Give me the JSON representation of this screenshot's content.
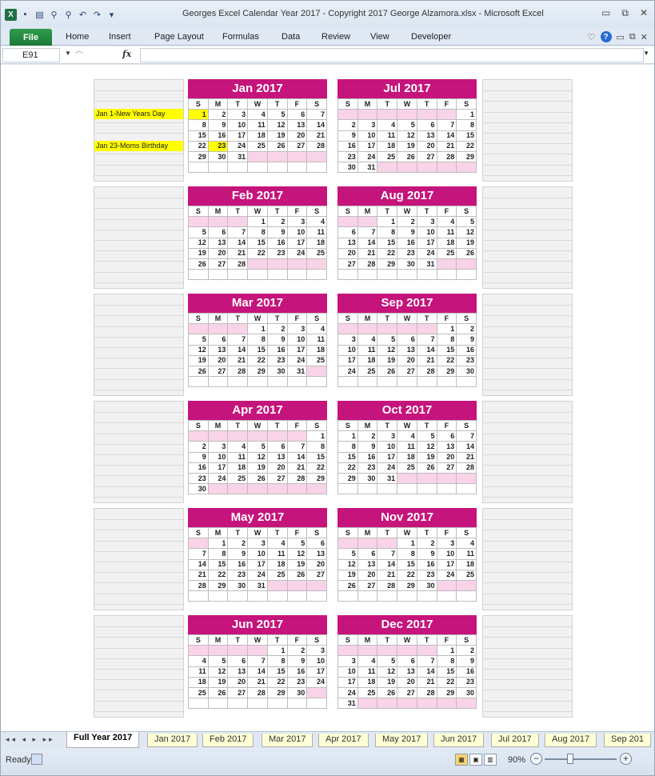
{
  "window": {
    "title": "Georges Excel Calendar Year 2017  -  Copyright 2017 George Alzamora.xlsx  -  Microsoft Excel",
    "minimize": "▭",
    "restore": "⧉",
    "close": "✕"
  },
  "ribbon": {
    "file": "File",
    "tabs": [
      "Home",
      "Insert",
      "Page Layout",
      "Formulas",
      "Data",
      "Review",
      "View",
      "Developer"
    ],
    "help": "?"
  },
  "formula_bar": {
    "name_box": "E91",
    "fx": "fx",
    "value": ""
  },
  "day_headers": [
    "S",
    "M",
    "T",
    "W",
    "T",
    "F",
    "S"
  ],
  "notes": {
    "jan1": "Jan 1-New Years Day",
    "jan23": "Jan 23-Moms Birthday"
  },
  "months": [
    {
      "name": "Jan 2017",
      "start": 0,
      "days": 31,
      "highlight": [
        1,
        23
      ]
    },
    {
      "name": "Feb 2017",
      "start": 3,
      "days": 28,
      "highlight": []
    },
    {
      "name": "Mar 2017",
      "start": 3,
      "days": 31,
      "highlight": []
    },
    {
      "name": "Apr 2017",
      "start": 6,
      "days": 30,
      "highlight": []
    },
    {
      "name": "May 2017",
      "start": 1,
      "days": 31,
      "highlight": []
    },
    {
      "name": "Jun 2017",
      "start": 4,
      "days": 30,
      "highlight": []
    },
    {
      "name": "Jul 2017",
      "start": 6,
      "days": 31,
      "highlight": []
    },
    {
      "name": "Aug 2017",
      "start": 2,
      "days": 31,
      "highlight": []
    },
    {
      "name": "Sep 2017",
      "start": 5,
      "days": 30,
      "highlight": []
    },
    {
      "name": "Oct 2017",
      "start": 0,
      "days": 31,
      "highlight": []
    },
    {
      "name": "Nov 2017",
      "start": 3,
      "days": 30,
      "highlight": []
    },
    {
      "name": "Dec 2017",
      "start": 5,
      "days": 31,
      "highlight": []
    }
  ],
  "sheet_tabs": [
    "Full Year 2017",
    "Jan 2017",
    "Feb 2017",
    "Mar 2017",
    "Apr 2017",
    "May 2017",
    "Jun 2017",
    "Jul 2017",
    "Aug 2017",
    "Sep 201"
  ],
  "status": {
    "ready": "Ready",
    "zoom": "90%",
    "zoom_level": 0.9
  },
  "colors": {
    "month_header": "#c5147b",
    "pad_cell": "#f9d3e8",
    "highlight": "#ffff00",
    "file_tab": "#1f8a3b"
  }
}
